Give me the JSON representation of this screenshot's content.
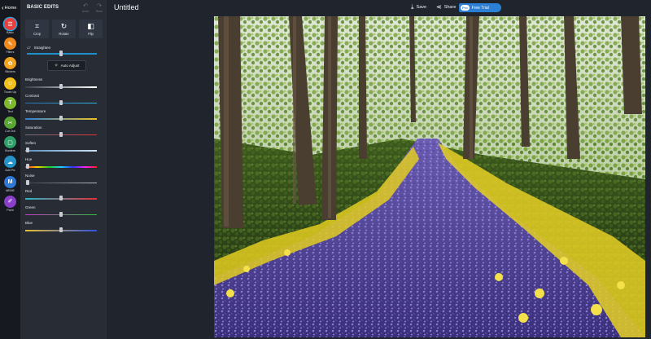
{
  "nav": {
    "home_label": "Home"
  },
  "tools": [
    {
      "id": "basic",
      "label": "Basic",
      "color": "#e8403c",
      "glyph": "☰",
      "active": true
    },
    {
      "id": "filters",
      "label": "Filters",
      "color": "#f08a1c",
      "glyph": "✎"
    },
    {
      "id": "stickers",
      "label": "Stickers",
      "color": "#f3a31e",
      "glyph": "✿"
    },
    {
      "id": "touch-up",
      "label": "Touch Up",
      "color": "#f2c01c",
      "glyph": "☺"
    },
    {
      "id": "text",
      "label": "Text",
      "color": "#7fba2e",
      "glyph": "T"
    },
    {
      "id": "cut-out",
      "label": "Cut Out",
      "color": "#5aa635",
      "glyph": "✂"
    },
    {
      "id": "borders",
      "label": "Borders",
      "color": "#2fa06a",
      "glyph": "▢"
    },
    {
      "id": "add-pic",
      "label": "Add Pic",
      "color": "#2693c9",
      "glyph": "☁"
    },
    {
      "id": "meme",
      "label": "MEME",
      "color": "#2f78d6",
      "glyph": "M"
    },
    {
      "id": "paint",
      "label": "Paint",
      "color": "#8a3fc9",
      "glyph": "✐"
    }
  ],
  "panel": {
    "title": "BASIC EDITS",
    "undo_label": "Undo",
    "redo_label": "Redo",
    "crop_label": "Crop",
    "rotate_label": "Rotate",
    "flip_label": "Flip",
    "straighten_label": "Straighten",
    "auto_adjust_label": "Auto Adjust",
    "adjustments": [
      {
        "label": "Brightness",
        "value": 0.5,
        "gradient": [
          "#3a3f48",
          "#ffffff"
        ]
      },
      {
        "label": "Contrast",
        "value": 0.5,
        "gradient": [
          "#2a6fb0",
          "#2fb6e6"
        ]
      },
      {
        "label": "Temperature",
        "value": 0.5,
        "gradient": [
          "#2f7fd6",
          "#e9c229"
        ]
      },
      {
        "label": "Saturation",
        "value": 0.5,
        "gradient": [
          "#6d7079",
          "#e0333a"
        ]
      },
      {
        "label": "Soften",
        "value": 0.03,
        "gradient": [
          "#5a8fbf",
          "#cfe2f2"
        ]
      },
      {
        "label": "Hue",
        "value": 0.03,
        "gradient": [
          "#ff2020",
          "#ffd000",
          "#20d020",
          "#20d0ff",
          "#3030ff",
          "#ff20ff",
          "#ff2020"
        ]
      },
      {
        "label": "Noise",
        "value": 0.03,
        "gradient": [
          "#3a3f48",
          "#b8bcc4"
        ]
      },
      {
        "label": "Red",
        "value": 0.5,
        "gradient": [
          "#28b8c8",
          "#e0303a"
        ]
      },
      {
        "label": "Green",
        "value": 0.5,
        "gradient": [
          "#c838c8",
          "#30c040"
        ]
      },
      {
        "label": "Blue",
        "value": 0.5,
        "gradient": [
          "#e8c030",
          "#3050e0"
        ]
      }
    ]
  },
  "topbar": {
    "document_title": "Untitled",
    "save_label": "Save",
    "share_label": "Share",
    "pro_label": "Pro",
    "free_trial_label": "Free Trial"
  }
}
